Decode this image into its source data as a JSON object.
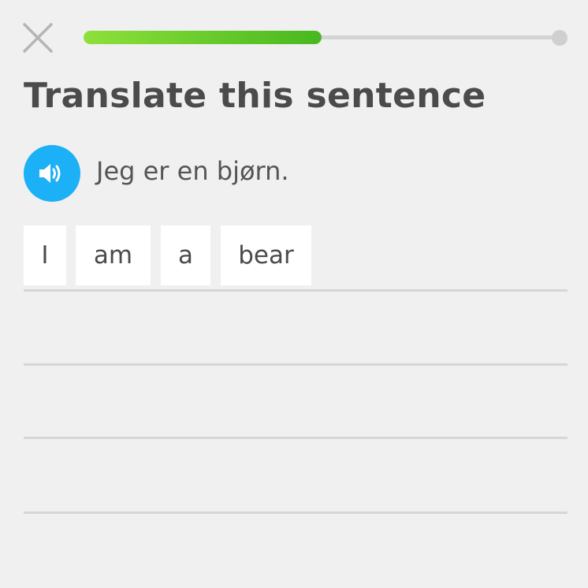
{
  "header": {
    "close_icon": "close-icon",
    "progress": {
      "fraction": 0.5,
      "fill_color_start": "#8ee03a",
      "fill_color_end": "#47b820",
      "track_color": "#d4d4d4"
    }
  },
  "exercise": {
    "title": "Translate this sentence",
    "speaker_icon": "speaker-icon",
    "accent_color": "#1cb0f6",
    "prompt": "Jeg er en bjørn."
  },
  "answer": {
    "tiles": [
      "I",
      "am",
      "a",
      "bear"
    ]
  }
}
